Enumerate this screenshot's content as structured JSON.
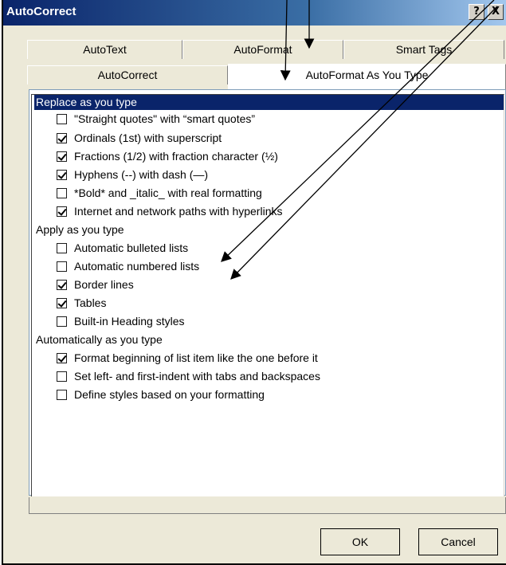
{
  "window": {
    "title": "AutoCorrect",
    "help_glyph": "?",
    "close_glyph": "X"
  },
  "tabs": {
    "back_row": [
      "AutoText",
      "AutoFormat",
      "Smart Tags"
    ],
    "front_row": [
      "AutoCorrect",
      "AutoFormat As You Type"
    ],
    "active": "AutoFormat As You Type"
  },
  "groups": [
    {
      "header": "Replace as you type",
      "selected": true,
      "items": [
        {
          "label": "\"Straight quotes\" with “smart quotes”",
          "checked": false
        },
        {
          "label": "Ordinals (1st) with superscript",
          "checked": true
        },
        {
          "label": "Fractions (1/2) with fraction character (½)",
          "checked": true
        },
        {
          "label": "Hyphens (--) with dash (—)",
          "checked": true
        },
        {
          "label": "*Bold* and _italic_ with real formatting",
          "checked": false
        },
        {
          "label": "Internet and network paths with hyperlinks",
          "checked": true
        }
      ]
    },
    {
      "header": "Apply as you type",
      "selected": false,
      "items": [
        {
          "label": "Automatic bulleted lists",
          "checked": false
        },
        {
          "label": "Automatic numbered lists",
          "checked": false
        },
        {
          "label": "Border lines",
          "checked": true
        },
        {
          "label": "Tables",
          "checked": true
        },
        {
          "label": "Built-in Heading styles",
          "checked": false
        }
      ]
    },
    {
      "header": "Automatically as you type",
      "selected": false,
      "items": [
        {
          "label": "Format beginning of list item like the one before it",
          "checked": true
        },
        {
          "label": "Set left- and first-indent with tabs and backspaces",
          "checked": false
        },
        {
          "label": "Define styles based on your formatting",
          "checked": false
        }
      ]
    }
  ],
  "buttons": {
    "ok": "OK",
    "cancel": "Cancel"
  },
  "colors": {
    "title_bar": "#0a246a",
    "selection": "#0a246a",
    "face": "#ece9d8",
    "arrow": "#000000"
  }
}
